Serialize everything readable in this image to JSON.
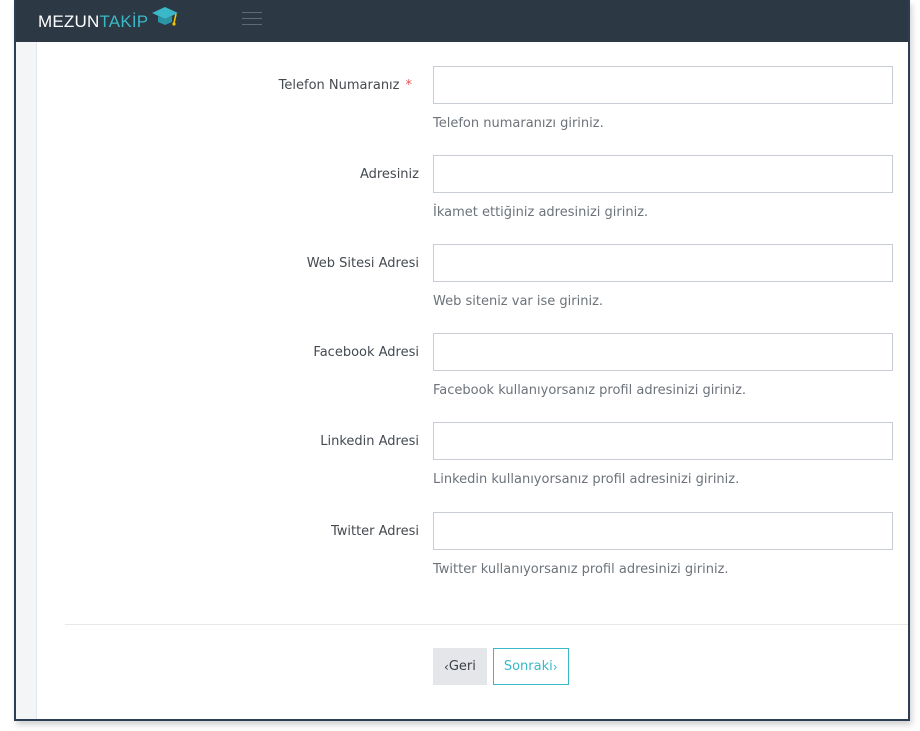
{
  "header": {
    "brand_part1": "MEZUN",
    "brand_part2": "TAKİP",
    "brand_color": "#3ab8c8",
    "logo_icon": "graduation-cap-icon",
    "menu_icon": "hamburger-menu-icon"
  },
  "form": {
    "fields": [
      {
        "label": "Telefon Numaranız",
        "required_mark": "*",
        "value": "",
        "help": "Telefon numaranızı giriniz."
      },
      {
        "label": "Adresiniz",
        "value": "",
        "help": "İkamet ettiğiniz adresinizi giriniz."
      },
      {
        "label": "Web Sitesi Adresi",
        "value": "",
        "help": "Web siteniz var ise giriniz."
      },
      {
        "label": "Facebook Adresi",
        "value": "",
        "help": "Facebook kullanıyorsanız profil adresinizi giriniz."
      },
      {
        "label": "Linkedin Adresi",
        "value": "",
        "help": "Linkedin kullanıyorsanız profil adresinizi giriniz."
      },
      {
        "label": "Twitter Adresi",
        "value": "",
        "help": "Twitter kullanıyorsanız profil adresinizi giriniz."
      }
    ]
  },
  "actions": {
    "back_chevron": "‹",
    "back_label": "Geri",
    "next_label": "Sonraki",
    "next_chevron": "›"
  }
}
